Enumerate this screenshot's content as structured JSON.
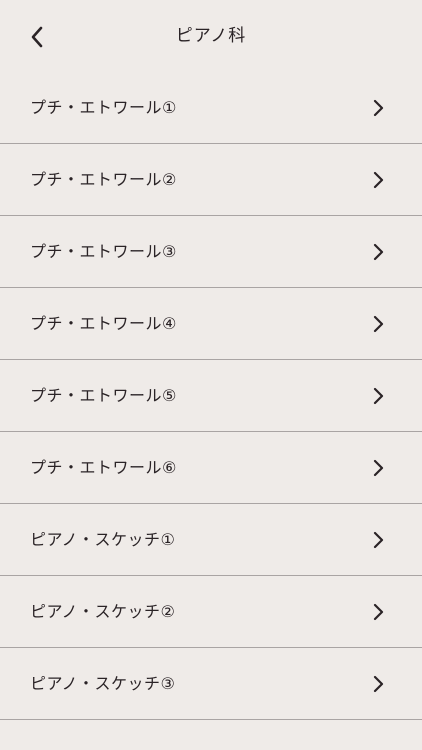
{
  "header": {
    "title": "ピアノ科",
    "back_icon": "chevron-left-icon"
  },
  "list": {
    "items": [
      {
        "label": "プチ・エトワール①"
      },
      {
        "label": "プチ・エトワール②"
      },
      {
        "label": "プチ・エトワール③"
      },
      {
        "label": "プチ・エトワール④"
      },
      {
        "label": "プチ・エトワール⑤"
      },
      {
        "label": "プチ・エトワール⑥"
      },
      {
        "label": "ピアノ・スケッチ①"
      },
      {
        "label": "ピアノ・スケッチ②"
      },
      {
        "label": "ピアノ・スケッチ③"
      }
    ],
    "item_icon": "chevron-right-icon"
  },
  "colors": {
    "background": "#efebe8",
    "text": "#2a2326",
    "divider": "#a9a4a3"
  }
}
